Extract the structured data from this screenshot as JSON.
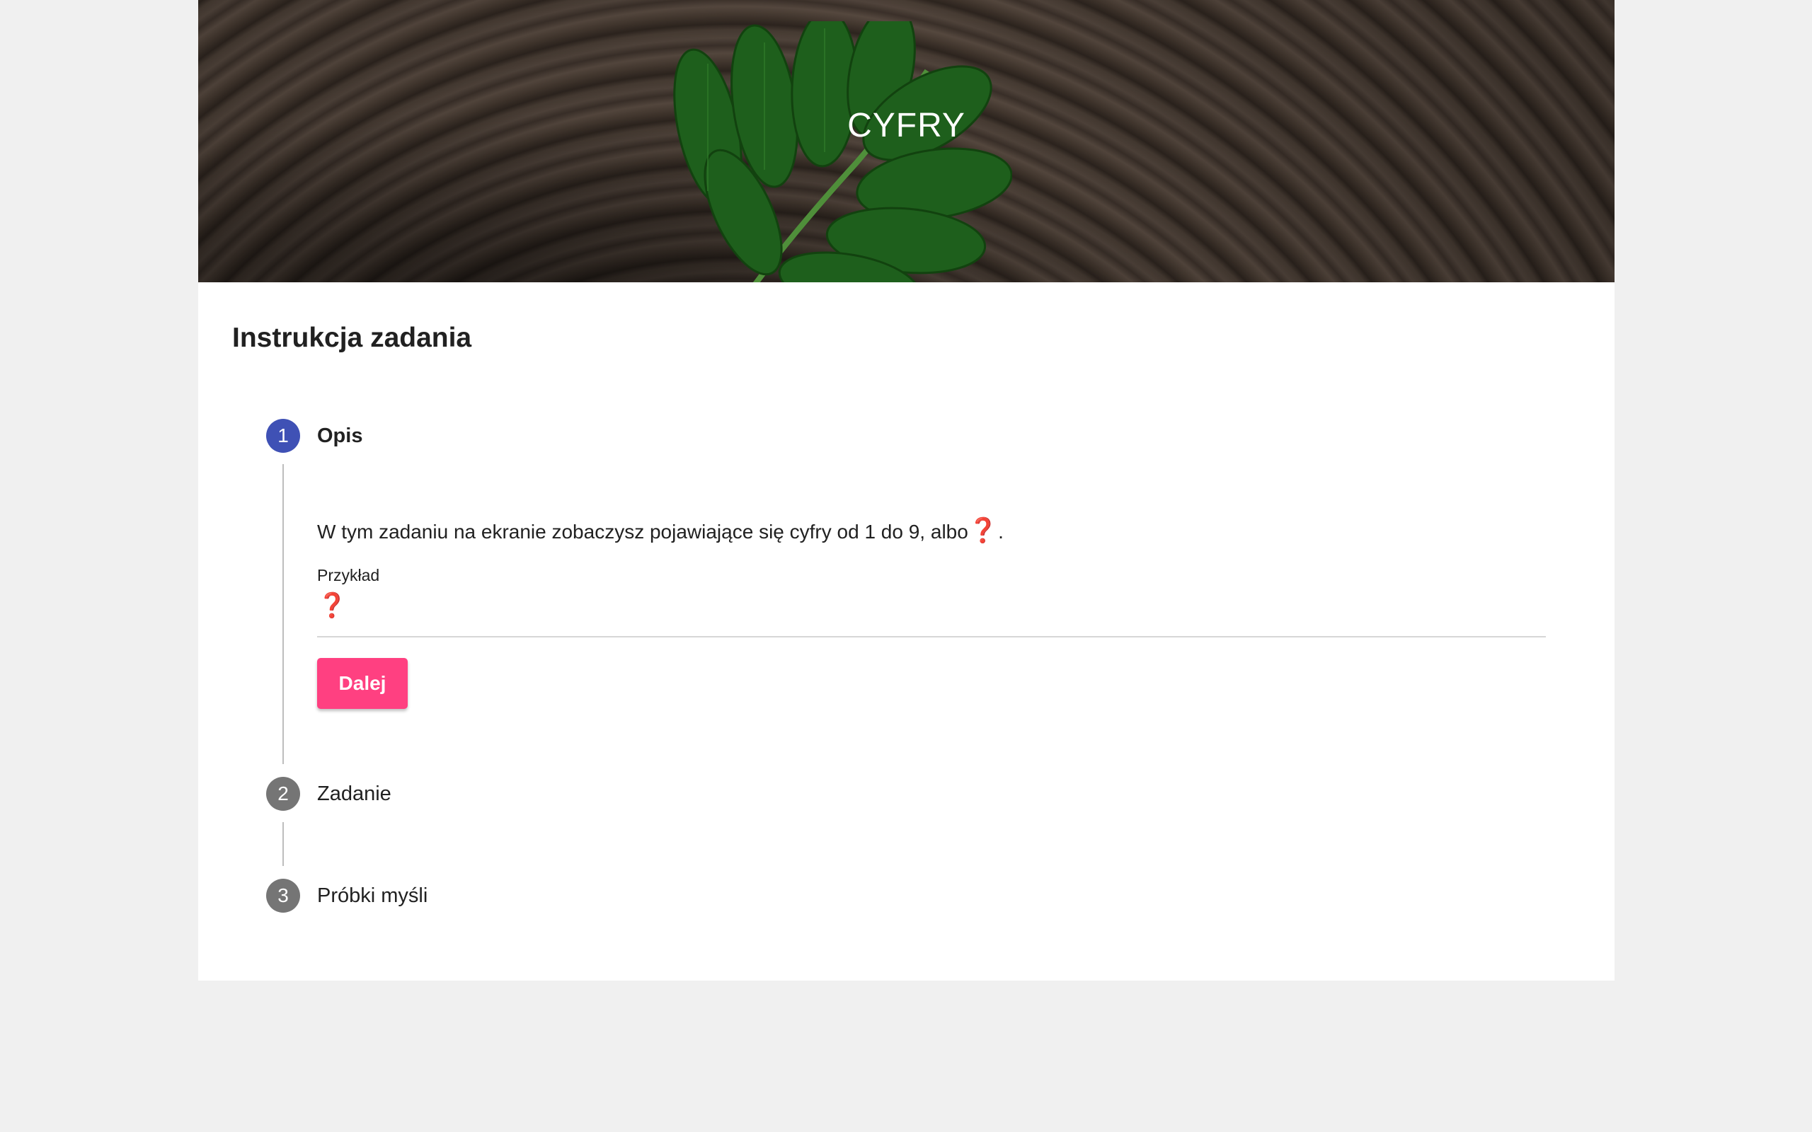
{
  "header": {
    "title": "CYFRY"
  },
  "card": {
    "heading": "Instrukcja zadania"
  },
  "steps": [
    {
      "number": "1",
      "label": "Opis",
      "state": "active"
    },
    {
      "number": "2",
      "label": "Zadanie",
      "state": "inactive"
    },
    {
      "number": "3",
      "label": "Próbki myśli",
      "state": "inactive"
    }
  ],
  "step1": {
    "description": "W tym zadaniu na ekranie zobaczysz pojawiające się cyfry od 1 do 9, albo",
    "description_symbol": "❓",
    "description_end": ".",
    "example_label": "Przykład",
    "example_value": "❓",
    "next_button": "Dalej"
  },
  "colors": {
    "active_step": "#3f51b5",
    "inactive_step": "#757575",
    "accent_button": "#ff4081",
    "question_mark": "#e0001b"
  }
}
